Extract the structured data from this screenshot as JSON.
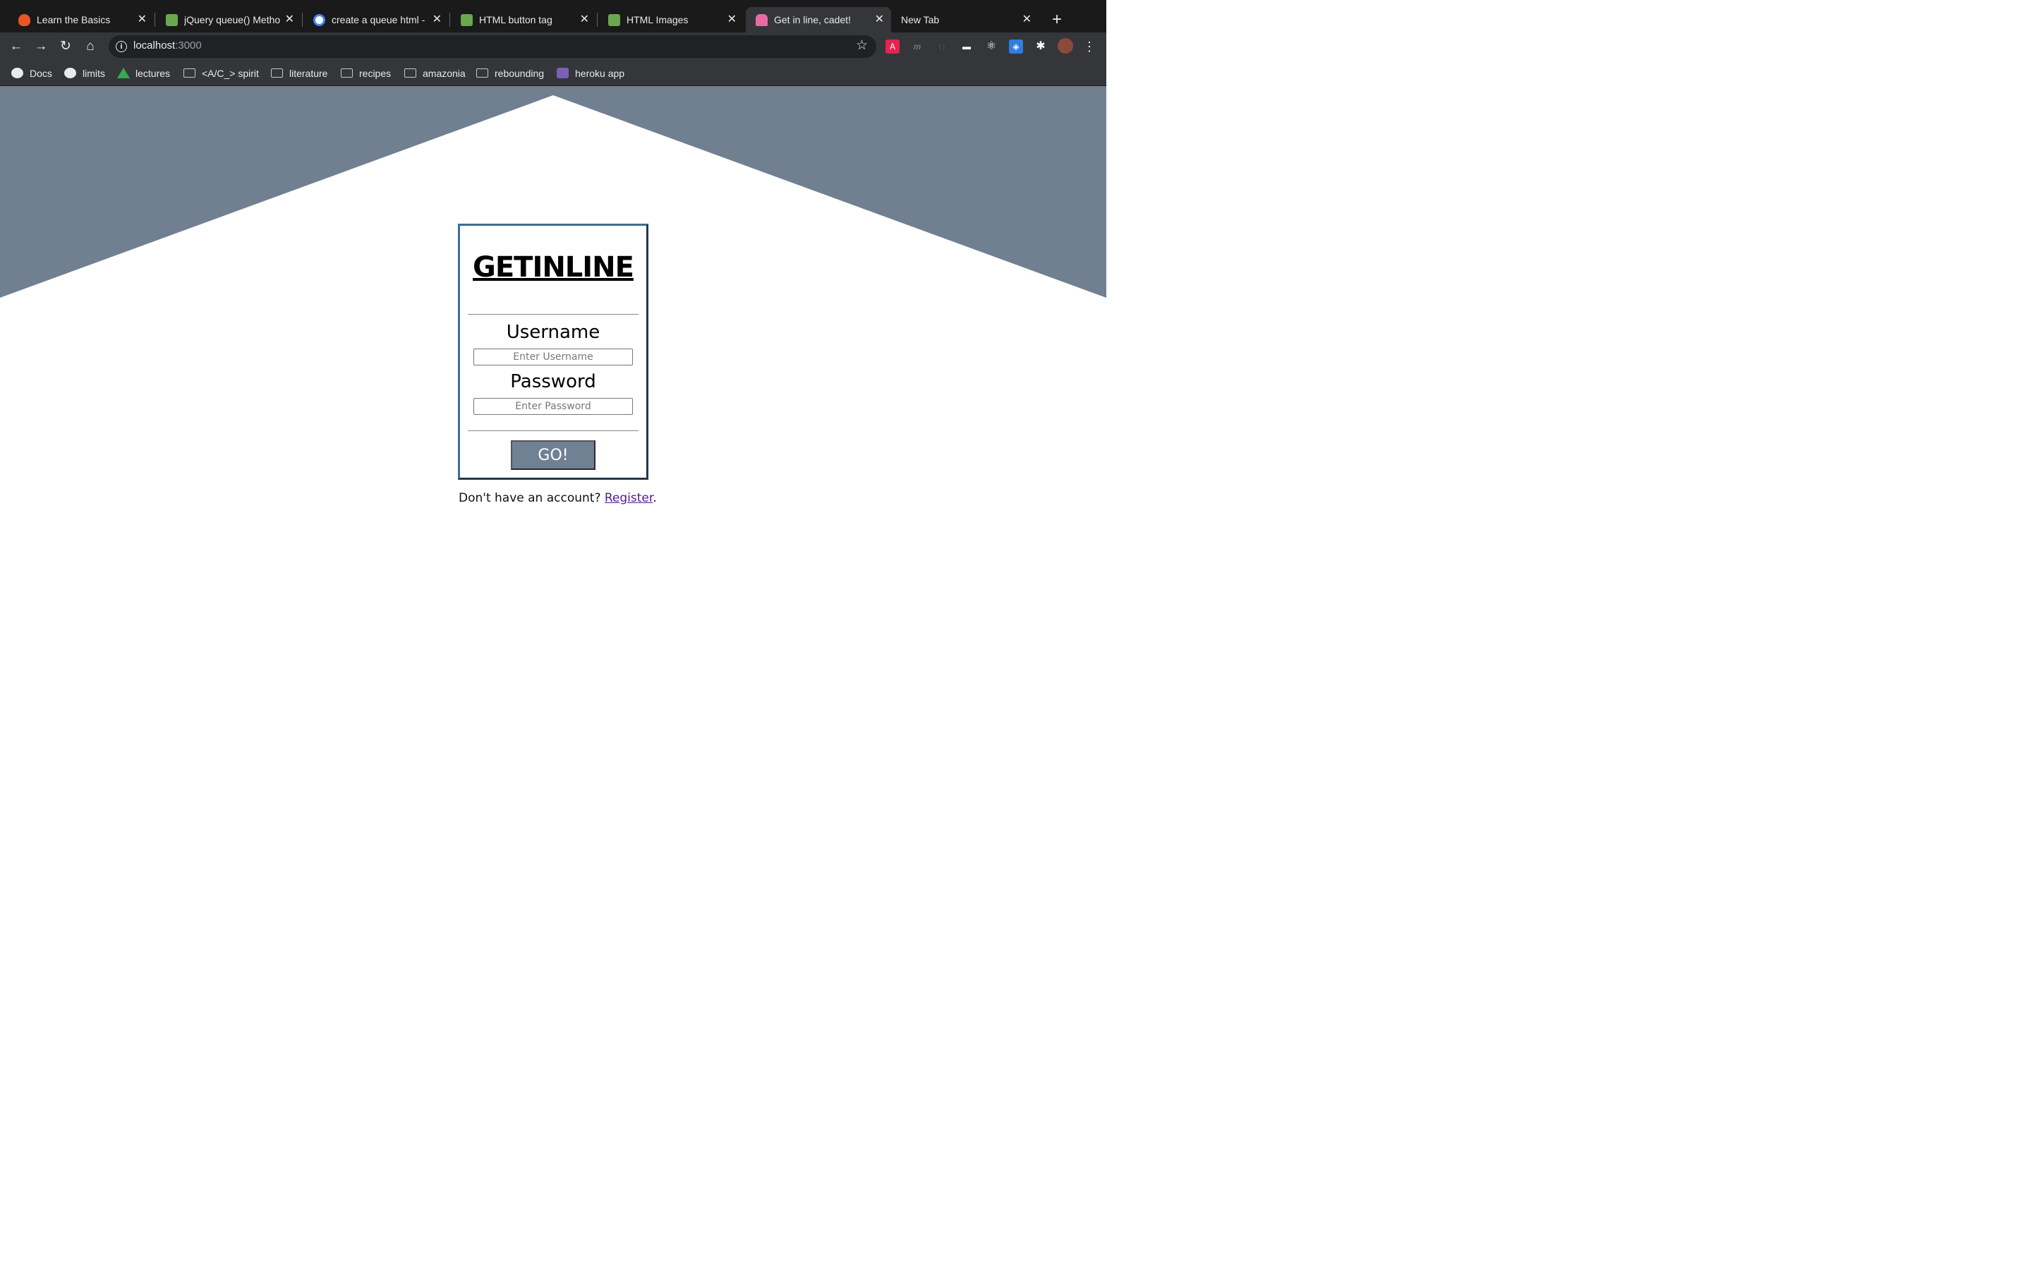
{
  "browser": {
    "tabs": [
      {
        "title": "Learn the Basics",
        "favicon": "auth0-shield-icon",
        "favicon_color": "#eb5424",
        "active": false
      },
      {
        "title": "jQuery queue() Metho",
        "favicon": "w3schools-icon",
        "favicon_color": "#6aa84f",
        "active": false
      },
      {
        "title": "create a queue html - ",
        "favicon": "google-icon",
        "favicon_color": "#4285f4",
        "active": false
      },
      {
        "title": "HTML button tag",
        "favicon": "w3schools-icon",
        "favicon_color": "#6aa84f",
        "active": false
      },
      {
        "title": "HTML Images",
        "favicon": "w3schools-icon",
        "favicon_color": "#6aa84f",
        "active": false
      },
      {
        "title": "Get in line, cadet!",
        "favicon": "roller-skate-icon",
        "favicon_color": "#e86aa5",
        "active": true
      },
      {
        "title": "New Tab",
        "favicon": "",
        "favicon_color": "",
        "active": false
      }
    ],
    "url": {
      "host": "localhost",
      "port": ":3000"
    },
    "bookmarks": [
      {
        "label": "Docs",
        "icon": "globe-icon"
      },
      {
        "label": "limits",
        "icon": "globe-icon"
      },
      {
        "label": "lectures",
        "icon": "google-drive-icon"
      },
      {
        "label": "<A/C_> spirit",
        "icon": "folder-icon"
      },
      {
        "label": "literature",
        "icon": "folder-icon"
      },
      {
        "label": "recipes",
        "icon": "folder-icon"
      },
      {
        "label": "amazonia",
        "icon": "folder-icon"
      },
      {
        "label": "rebounding",
        "icon": "folder-icon"
      },
      {
        "label": "heroku app",
        "icon": "heroku-icon"
      }
    ]
  },
  "page": {
    "background_color": "#708090",
    "brand": "GETINLINE",
    "username_label": "Username",
    "username_placeholder": "Enter Username",
    "password_label": "Password",
    "password_placeholder": "Enter Password",
    "submit_label": "GO!",
    "register_prompt": "Don't have an account? ",
    "register_link": "Register",
    "register_suffix": "."
  }
}
